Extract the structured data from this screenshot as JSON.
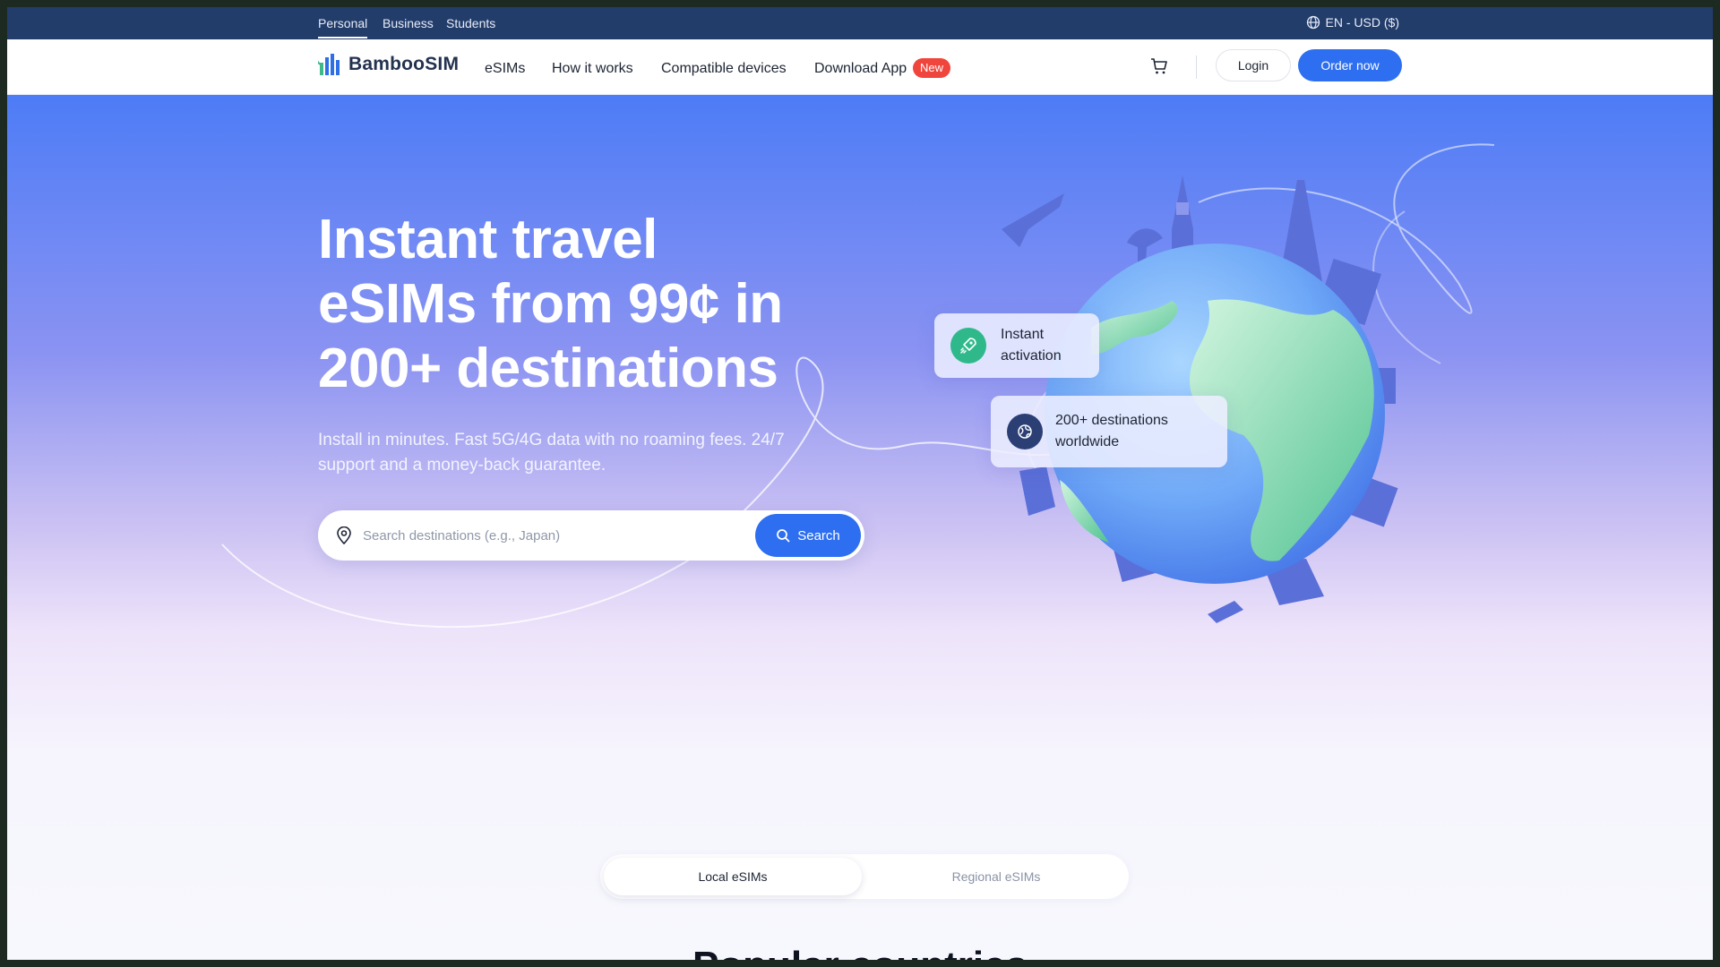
{
  "topbar": {
    "segments": [
      "Personal",
      "Business",
      "Students"
    ],
    "active_segment": "Personal",
    "locale": "EN - USD ($)",
    "locale_icon": "globe-icon"
  },
  "header": {
    "logo_text": "BambooSIM",
    "nav": [
      "eSIMs",
      "How it works",
      "Compatible devices",
      "Download App"
    ],
    "new_badge": "New",
    "cart_icon": "cart-icon",
    "login_label": "Login",
    "order_label": "Order now"
  },
  "hero": {
    "title_line1": "Instant travel",
    "title_line2": "eSIMs from 99¢ in",
    "title_line3": "200+ destinations",
    "subtitle": "Install in minutes. Fast 5G/4G data with no roaming fees. 24/7 support and a money-back guarantee.",
    "search_placeholder": "Search destinations (e.g., Japan)",
    "search_label": "Search",
    "features": [
      {
        "label": "Instant activation",
        "icon": "rocket-icon",
        "color": "#2fb98b"
      },
      {
        "label_line1": "200+ destinations",
        "label_line2": "worldwide",
        "icon": "globe-icon",
        "color": "#2b3f75"
      }
    ]
  },
  "tabs": {
    "local": "Local eSIMs",
    "regional": "Regional eSIMs"
  },
  "section": {
    "title": "Popular countries"
  },
  "colors": {
    "primary": "#2d6ff0",
    "topbar": "#233d6b",
    "badge": "#f0453c"
  }
}
